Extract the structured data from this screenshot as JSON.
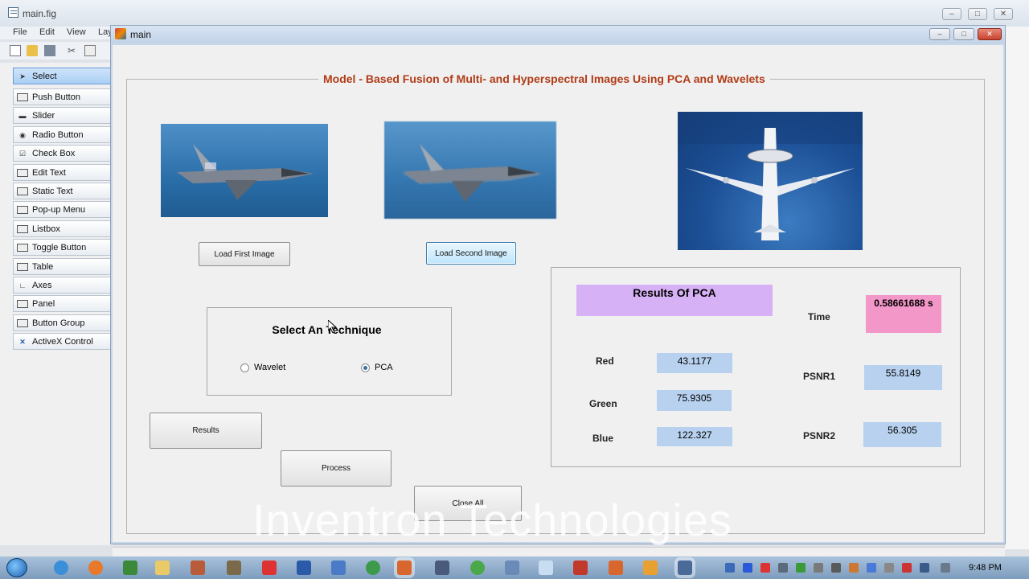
{
  "guide": {
    "title": "main.fig",
    "menus": [
      "File",
      "Edit",
      "View",
      "Lay"
    ],
    "palette": [
      {
        "label": "Select",
        "icon": "arrow-cursor-icon"
      },
      {
        "label": "Push Button",
        "icon": "push-button-icon"
      },
      {
        "label": "Slider",
        "icon": "slider-icon"
      },
      {
        "label": "Radio Button",
        "icon": "radio-button-icon"
      },
      {
        "label": "Check Box",
        "icon": "check-box-icon"
      },
      {
        "label": "Edit Text",
        "icon": "edit-text-icon"
      },
      {
        "label": "Static Text",
        "icon": "static-text-icon"
      },
      {
        "label": "Pop-up Menu",
        "icon": "popup-menu-icon"
      },
      {
        "label": "Listbox",
        "icon": "listbox-icon"
      },
      {
        "label": "Toggle Button",
        "icon": "toggle-button-icon"
      },
      {
        "label": "Table",
        "icon": "table-icon"
      },
      {
        "label": "Axes",
        "icon": "axes-icon"
      },
      {
        "label": "Panel",
        "icon": "panel-icon"
      },
      {
        "label": "Button Group",
        "icon": "button-group-icon"
      },
      {
        "label": "ActiveX Control",
        "icon": "activex-icon"
      }
    ]
  },
  "figure": {
    "title": "main",
    "heading": "Model - Based Fusion of Multi- and Hyperspectral Images Using PCA and Wavelets",
    "buttons": {
      "load_first": "Load First Image",
      "load_second": "Load Second Image",
      "results": "Results",
      "process": "Process",
      "close_all": "Close All"
    },
    "technique": {
      "title": "Select An Technique",
      "options": [
        "Wavelet",
        "PCA"
      ],
      "selected": "PCA"
    },
    "results": {
      "header": "Results Of PCA",
      "time_label": "Time",
      "time_value": "0.58661688 s",
      "red_label": "Red",
      "red_value": "43.1177",
      "green_label": "Green",
      "green_value": "75.9305",
      "blue_label": "Blue",
      "blue_value": "122.327",
      "psnr1_label": "PSNR1",
      "psnr1_value": "55.8149",
      "psnr2_label": "PSNR2",
      "psnr2_value": "56.305"
    }
  },
  "watermark": "Inventron Technologies",
  "taskbar": {
    "clock": "9:48 PM"
  },
  "colors": {
    "heading": "#b13b16",
    "pca_header": "#d7b1f5",
    "time_box": "#f396c8",
    "value_box": "#b7d1ef"
  }
}
